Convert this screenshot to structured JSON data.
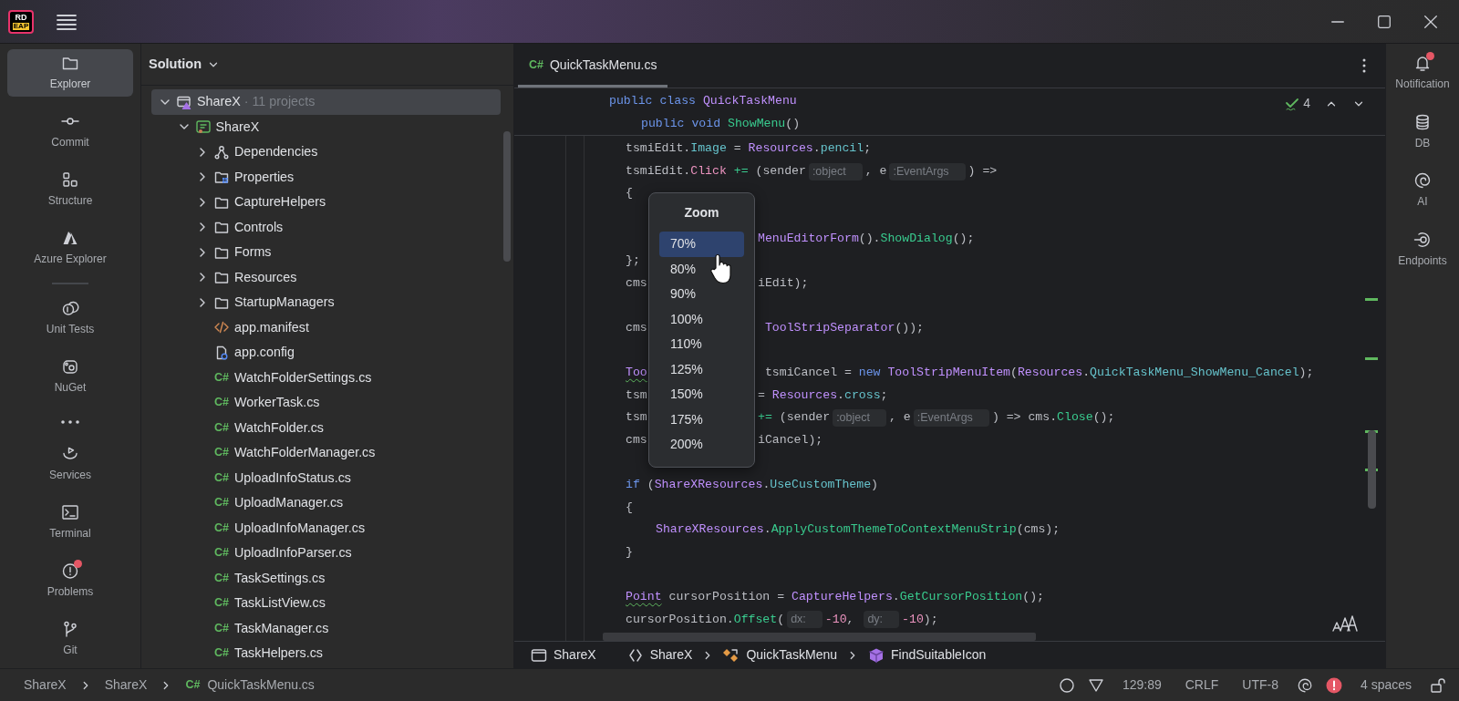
{
  "titlebar": {
    "logo": {
      "text": "RD",
      "badge": "EAP"
    }
  },
  "tool_strip": [
    {
      "kind": "tool",
      "label": "Explorer",
      "selected": true,
      "alert": false
    },
    {
      "kind": "tool",
      "label": "Commit",
      "selected": false,
      "alert": false
    },
    {
      "kind": "tool",
      "label": "Structure",
      "selected": false,
      "alert": false
    },
    {
      "kind": "tool",
      "label": "Azure Explorer",
      "selected": false,
      "alert": false
    },
    {
      "kind": "separator"
    },
    {
      "kind": "tool",
      "label": "Unit Tests",
      "selected": false,
      "alert": false
    },
    {
      "kind": "tool",
      "label": "NuGet",
      "selected": false,
      "alert": false
    },
    {
      "kind": "more"
    },
    {
      "kind": "tool",
      "label": "Services",
      "selected": false,
      "alert": false
    },
    {
      "kind": "tool",
      "label": "Terminal",
      "selected": false,
      "alert": false
    },
    {
      "kind": "tool",
      "label": "Problems",
      "selected": false,
      "alert": true
    },
    {
      "kind": "tool",
      "label": "Git",
      "selected": false,
      "alert": false
    }
  ],
  "solution": {
    "title": "Solution",
    "tree": [
      {
        "label": "ShareX",
        "note": "· 11 projects",
        "kind": "solution",
        "expanded": true,
        "selected": true,
        "children": [
          {
            "label": "ShareX",
            "kind": "project",
            "expanded": true,
            "selected": false,
            "children": [
              {
                "label": "Dependencies",
                "kind": "dependencies",
                "expanded": false,
                "selected": false
              },
              {
                "label": "Properties",
                "kind": "properties",
                "expanded": false,
                "selected": false
              },
              {
                "label": "CaptureHelpers",
                "kind": "folder",
                "expanded": false,
                "selected": false
              },
              {
                "label": "Controls",
                "kind": "folder",
                "expanded": false,
                "selected": false
              },
              {
                "label": "Forms",
                "kind": "folder",
                "expanded": false,
                "selected": false
              },
              {
                "label": "Resources",
                "kind": "folder",
                "expanded": false,
                "selected": false
              },
              {
                "label": "StartupManagers",
                "kind": "folder",
                "expanded": false,
                "selected": false
              },
              {
                "label": "app.manifest",
                "kind": "manifest",
                "selected": false
              },
              {
                "label": "app.config",
                "kind": "config",
                "selected": false
              },
              {
                "label": "WatchFolderSettings.cs",
                "kind": "csharp",
                "tag": "C#",
                "selected": false
              },
              {
                "label": "WorkerTask.cs",
                "kind": "csharp",
                "tag": "C#",
                "selected": false
              },
              {
                "label": "WatchFolder.cs",
                "kind": "csharp",
                "tag": "C#",
                "selected": false
              },
              {
                "label": "WatchFolderManager.cs",
                "kind": "csharp",
                "tag": "C#",
                "selected": false
              },
              {
                "label": "UploadInfoStatus.cs",
                "kind": "csharp",
                "tag": "C#",
                "selected": false
              },
              {
                "label": "UploadManager.cs",
                "kind": "csharp",
                "tag": "C#",
                "selected": false
              },
              {
                "label": "UploadInfoManager.cs",
                "kind": "csharp",
                "tag": "C#",
                "selected": false
              },
              {
                "label": "UploadInfoParser.cs",
                "kind": "csharp",
                "tag": "C#",
                "selected": false
              },
              {
                "label": "TaskSettings.cs",
                "kind": "csharp",
                "tag": "C#",
                "selected": false
              },
              {
                "label": "TaskListView.cs",
                "kind": "csharp",
                "tag": "C#",
                "selected": false
              },
              {
                "label": "TaskManager.cs",
                "kind": "csharp",
                "tag": "C#",
                "selected": false
              },
              {
                "label": "TaskHelpers.cs",
                "kind": "csharp",
                "tag": "C#",
                "selected": false
              }
            ]
          }
        ]
      }
    ]
  },
  "editor": {
    "tabs": [
      {
        "tag": "C#",
        "label": "QuickTaskMenu.cs",
        "selected": true
      }
    ],
    "inspections": "4",
    "sticky": [
      {
        "kind": "class",
        "tokens": [
          {
            "kind": "keyword",
            "text": "public"
          },
          {
            "kind": "keyword",
            "text": " class"
          },
          {
            "kind": "type",
            "text": " QuickTaskMenu"
          }
        ]
      },
      {
        "kind": "member",
        "tokens": [
          {
            "kind": "keyword",
            "text": "public"
          },
          {
            "kind": "keyword",
            "text": " void"
          },
          {
            "kind": "method",
            "text": " ShowMenu"
          },
          {
            "kind": "plain",
            "text": "()"
          }
        ]
      }
    ],
    "lines": [
      {
        "kind": "body",
        "left": [
          {
            "kind": "plain",
            "text": "tsmiEdit."
          },
          {
            "kind": "property",
            "text": "Image"
          },
          {
            "kind": "plain",
            "text": " = "
          },
          {
            "kind": "type",
            "text": "Resources"
          },
          {
            "kind": "plain",
            "text": "."
          },
          {
            "kind": "property",
            "text": "pencil"
          },
          {
            "kind": "plain",
            "text": ";"
          }
        ]
      },
      {
        "kind": "body",
        "left": [
          {
            "kind": "plain",
            "text": "tsmiEdit."
          },
          {
            "kind": "event",
            "text": "Click"
          },
          {
            "kind": "operator",
            "text": " +="
          },
          {
            "kind": "plain",
            "text": " (sender"
          },
          {
            "kind": "hint",
            "text": ":object"
          },
          {
            "kind": "plain",
            "text": ", e"
          },
          {
            "kind": "hint",
            "text": ":EventArgs"
          },
          {
            "kind": "plain",
            "text": ") =>"
          }
        ]
      },
      {
        "kind": "body",
        "left": [
          {
            "kind": "plain",
            "text": "{"
          }
        ]
      },
      {
        "kind": "blank"
      },
      {
        "kind": "inner",
        "right": [
          {
            "kind": "type",
            "text": "MenuEditorForm"
          },
          {
            "kind": "plain",
            "text": "()."
          },
          {
            "kind": "method",
            "text": "ShowDialog"
          },
          {
            "kind": "plain",
            "text": "();"
          }
        ]
      },
      {
        "kind": "body",
        "left": [
          {
            "kind": "plain",
            "text": "};"
          }
        ]
      },
      {
        "kind": "body",
        "left": [
          {
            "kind": "plain",
            "text": "cms"
          }
        ],
        "right": [
          {
            "kind": "plain",
            "text": "iEdit);"
          }
        ]
      },
      {
        "kind": "blank"
      },
      {
        "kind": "body",
        "left": [
          {
            "kind": "plain",
            "text": "cms"
          }
        ],
        "right": [
          {
            "kind": "type",
            "text": " ToolStripSeparator"
          },
          {
            "kind": "plain",
            "text": "());"
          }
        ]
      },
      {
        "kind": "blank"
      },
      {
        "kind": "body",
        "left": [
          {
            "kind": "warned_type",
            "text": "Too"
          }
        ],
        "right": [
          {
            "kind": "plain",
            "text": " tsmiCancel = "
          },
          {
            "kind": "keyword",
            "text": "new"
          },
          {
            "kind": "type",
            "text": " ToolStripMenuItem"
          },
          {
            "kind": "plain",
            "text": "("
          },
          {
            "kind": "type",
            "text": "Resources"
          },
          {
            "kind": "plain",
            "text": "."
          },
          {
            "kind": "property",
            "text": "QuickTaskMenu_ShowMenu_Cancel"
          },
          {
            "kind": "plain",
            "text": ");"
          }
        ]
      },
      {
        "kind": "body",
        "left": [
          {
            "kind": "plain",
            "text": "tsm"
          }
        ],
        "right": [
          {
            "kind": "plain",
            "text": "= "
          },
          {
            "kind": "type",
            "text": "Resources"
          },
          {
            "kind": "plain",
            "text": "."
          },
          {
            "kind": "property",
            "text": "cross"
          },
          {
            "kind": "plain",
            "text": ";"
          }
        ]
      },
      {
        "kind": "body",
        "left": [
          {
            "kind": "plain",
            "text": "tsm"
          }
        ],
        "right": [
          {
            "kind": "operator",
            "text": "+="
          },
          {
            "kind": "plain",
            "text": " (sender"
          },
          {
            "kind": "hint",
            "text": ":object"
          },
          {
            "kind": "plain",
            "text": ", e"
          },
          {
            "kind": "hint",
            "text": ":EventArgs"
          },
          {
            "kind": "plain",
            "text": ") => cms."
          },
          {
            "kind": "method",
            "text": "Close"
          },
          {
            "kind": "plain",
            "text": "();"
          }
        ]
      },
      {
        "kind": "body",
        "left": [
          {
            "kind": "plain",
            "text": "cms"
          }
        ],
        "right": [
          {
            "kind": "plain",
            "text": "iCancel);"
          }
        ]
      },
      {
        "kind": "blank"
      },
      {
        "kind": "body",
        "left": [
          {
            "kind": "keyword",
            "text": "if"
          },
          {
            "kind": "plain",
            "text": " ("
          },
          {
            "kind": "type",
            "text": "ShareXResources"
          },
          {
            "kind": "plain",
            "text": "."
          },
          {
            "kind": "property",
            "text": "UseCustomTheme"
          },
          {
            "kind": "plain",
            "text": ")"
          }
        ]
      },
      {
        "kind": "body",
        "left": [
          {
            "kind": "plain",
            "text": "{"
          }
        ]
      },
      {
        "kind": "inner",
        "left": [
          {
            "kind": "type",
            "text": "ShareXResources"
          },
          {
            "kind": "plain",
            "text": "."
          },
          {
            "kind": "method",
            "text": "ApplyCustomThemeToContextMenuStrip"
          },
          {
            "kind": "plain",
            "text": "(cms);"
          }
        ]
      },
      {
        "kind": "body",
        "left": [
          {
            "kind": "plain",
            "text": "}"
          }
        ]
      },
      {
        "kind": "blank"
      },
      {
        "kind": "body",
        "left": [
          {
            "kind": "warned_type",
            "text": "Point"
          },
          {
            "kind": "plain",
            "text": " cursorPosition = "
          },
          {
            "kind": "type",
            "text": "CaptureHelpers"
          },
          {
            "kind": "plain",
            "text": "."
          },
          {
            "kind": "method",
            "text": "GetCursorPosition"
          },
          {
            "kind": "plain",
            "text": "();"
          }
        ]
      },
      {
        "kind": "body",
        "left": [
          {
            "kind": "plain",
            "text": "cursorPosition."
          },
          {
            "kind": "method",
            "text": "Offset"
          },
          {
            "kind": "plain",
            "text": "("
          },
          {
            "kind": "hint",
            "text": "dx:"
          },
          {
            "kind": "number",
            "text": "-10"
          },
          {
            "kind": "plain",
            "text": ", "
          },
          {
            "kind": "hint",
            "text": "dy:"
          },
          {
            "kind": "number",
            "text": "-10"
          },
          {
            "kind": "plain",
            "text": ");"
          }
        ]
      }
    ],
    "zoom_menu": {
      "title": "Zoom",
      "options": [
        {
          "label": "70%",
          "selected": true
        },
        {
          "label": "80%",
          "selected": false
        },
        {
          "label": "90%",
          "selected": false
        },
        {
          "label": "100%",
          "selected": false
        },
        {
          "label": "110%",
          "selected": false
        },
        {
          "label": "125%",
          "selected": false
        },
        {
          "label": "150%",
          "selected": false
        },
        {
          "label": "175%",
          "selected": false
        },
        {
          "label": "200%",
          "selected": false
        }
      ]
    },
    "breadcrumb": [
      {
        "label": "ShareX"
      },
      {
        "label": "ShareX"
      },
      {
        "label": "QuickTaskMenu"
      },
      {
        "label": "FindSuitableIcon"
      }
    ]
  },
  "right_strip": [
    {
      "label": "Notification",
      "alert": true
    },
    {
      "label": "DB",
      "alert": false
    },
    {
      "label": "AI",
      "alert": false
    },
    {
      "label": "Endpoints",
      "alert": false
    }
  ],
  "status_bar": {
    "path": [
      {
        "label": "ShareX"
      },
      {
        "label": "ShareX"
      },
      {
        "tag": "C#",
        "label": "QuickTaskMenu.cs"
      }
    ],
    "position": "129:89",
    "line_ending": "CRLF",
    "encoding": "UTF-8",
    "indent": "4 spaces"
  }
}
